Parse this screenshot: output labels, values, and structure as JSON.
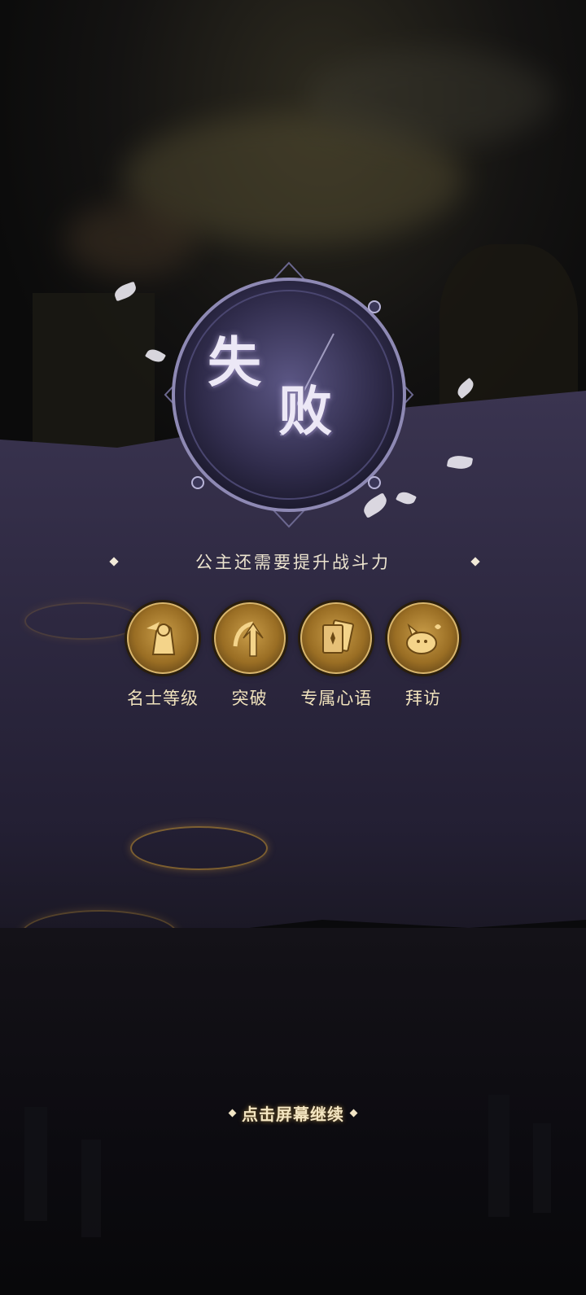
{
  "result": {
    "title_char_1": "失",
    "title_char_2": "败",
    "subtitle": "公主还需要提升战斗力"
  },
  "tips": [
    {
      "label": "名士等级",
      "icon": "hero-portrait-icon"
    },
    {
      "label": "突破",
      "icon": "breakthrough-arrow-icon"
    },
    {
      "label": "专属心语",
      "icon": "cards-icon"
    },
    {
      "label": "拜访",
      "icon": "pet-visit-icon"
    }
  ],
  "footer": {
    "continue_label": "点击屏幕继续"
  },
  "colors": {
    "gold": "#d8b56c",
    "purple_ribbon": "#3a3450",
    "text_cream": "#ece4cf"
  }
}
